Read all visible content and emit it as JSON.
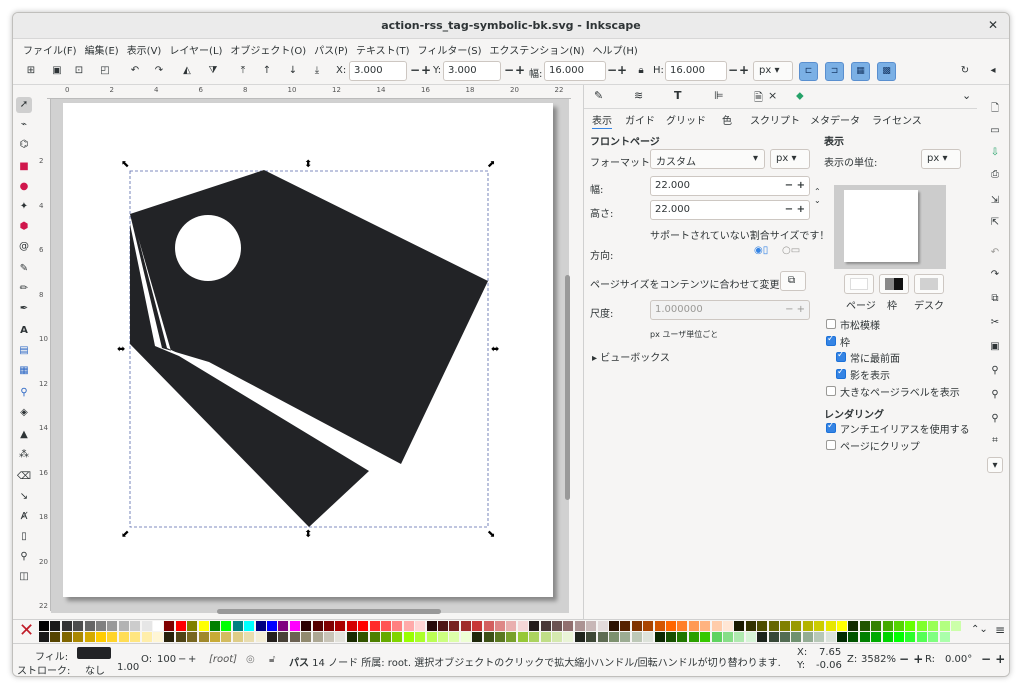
{
  "window": {
    "title": "action-rss_tag-symbolic-bk.svg - Inkscape"
  },
  "menu": [
    "ファイル(F)",
    "編集(E)",
    "表示(V)",
    "レイヤー(L)",
    "オブジェクト(O)",
    "パス(P)",
    "テキスト(T)",
    "フィルター(S)",
    "エクステンション(N)",
    "ヘルプ(H)"
  ],
  "toolbar": {
    "x_label": "X:",
    "x_value": "3.000",
    "y_label": "Y:",
    "y_value": "3.000",
    "w_label": "幅:",
    "w_value": "16.000",
    "h_label": "H:",
    "h_value": "16.000",
    "unit": "px",
    "minus": "−",
    "plus": "+"
  },
  "rulers": {
    "h": [
      "0",
      "2",
      "4",
      "6",
      "8",
      "10",
      "12",
      "14",
      "16",
      "18",
      "20",
      "22"
    ],
    "v": [
      "2",
      "4",
      "6",
      "8",
      "10",
      "12",
      "14",
      "16",
      "18",
      "20",
      "22"
    ]
  },
  "dock": {
    "tab_close": "×",
    "subtabs": [
      "表示",
      "ガイド",
      "グリッド",
      "色",
      "スクリプト",
      "メタデータ",
      "ライセンス"
    ],
    "front_page": "フロントページ",
    "format_label": "フォーマット:",
    "format_value": "カスタム",
    "format_unit": "px",
    "width_label": "幅:",
    "width_value": "22.000",
    "height_label": "高さ:",
    "height_value": "22.000",
    "unsupported": "サポートされていない割合サイズです！",
    "orientation_label": "方向:",
    "fit_label": "ページサイズをコンテンツに合わせて変更:",
    "scale_label": "尺度:",
    "scale_value": "1.000000",
    "scale_hint": "px ユーザ単位ごと",
    "viewbox": "ビューボックス",
    "display_header": "表示",
    "display_unit_label": "表示の単位:",
    "display_unit": "px",
    "sw_page": "ページ",
    "sw_border": "枠",
    "sw_desk": "デスク",
    "checker": "市松模様",
    "border": "枠",
    "always_front": "常に最前面",
    "show_shadow": "影を表示",
    "big_labels": "大きなページラベルを表示",
    "rendering": "レンダリング",
    "antialias": "アンチエイリアスを使用する",
    "clip": "ページにクリップ"
  },
  "status": {
    "fill_label": "フィル:",
    "stroke_label": "ストローク:",
    "stroke_value": "なし",
    "stroke_width": "1.00",
    "opacity_label": "O:",
    "opacity_value": "100",
    "layer": "[root]",
    "message_bold": "パス",
    "message": " 14 ノード 所属: root. 選択オブジェクトのクリックで拡大縮小ハンドル/回転ハンドルが切り替わります.",
    "x_label": "X:",
    "x_value": "7.65",
    "y_label": "Y:",
    "y_value": "-0.06",
    "zoom_label": "Z:",
    "zoom_value": "3582%",
    "rot_label": "R:",
    "rot_value": "0.00°"
  },
  "colors": {
    "shape": "#222326",
    "accent": "#3584e4",
    "fill_swatch": "#222326"
  }
}
